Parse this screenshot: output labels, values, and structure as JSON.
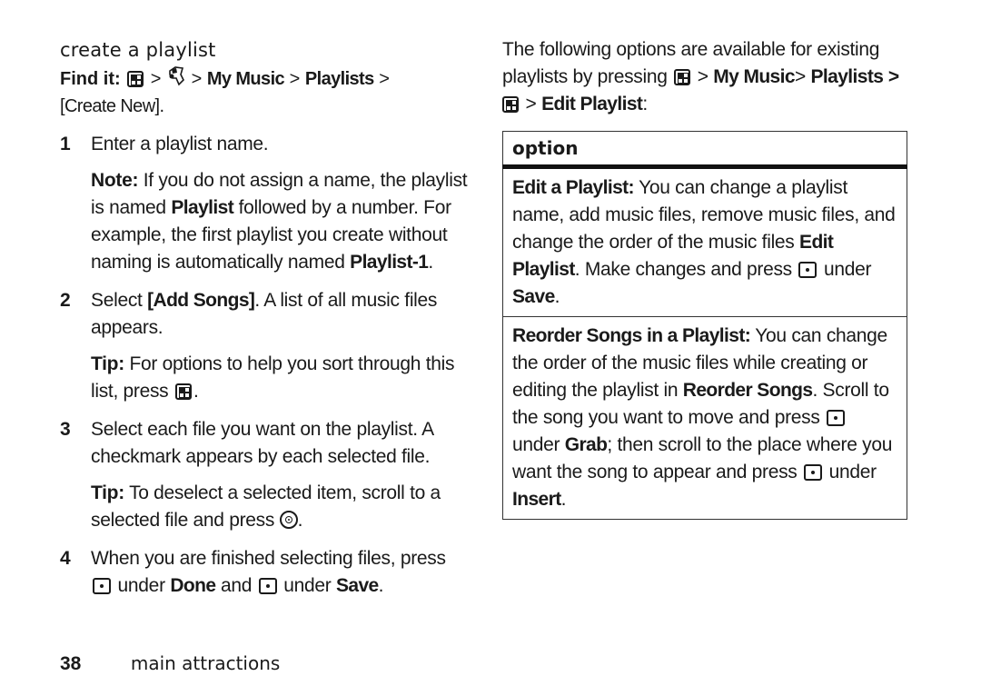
{
  "left": {
    "section_title": "create a playlist",
    "find_it": {
      "label": "Find it:",
      "path": [
        "menu-key-icon",
        ">",
        "music-icon",
        ">",
        "My Music",
        ">",
        "Playlists",
        ">",
        "[Create New]",
        "."
      ],
      "sep": ">",
      "my_music": "My Music",
      "playlists": "Playlists",
      "create_new": "[Create New]"
    },
    "steps": [
      {
        "num": "1",
        "text": "Enter a playlist name.",
        "note": {
          "label": "Note:",
          "parts": [
            "If you do not assign a name, the playlist is named ",
            "Playlist",
            " followed by a number. For example, the first playlist you create without naming is automatically named ",
            "Playlist-1",
            "."
          ]
        }
      },
      {
        "num": "2",
        "parts": [
          "Select ",
          "[Add Songs]",
          ". A list of all music files appears."
        ],
        "tip": {
          "label": "Tip:",
          "text": "For options to help you sort through this list, press",
          "end": "."
        }
      },
      {
        "num": "3",
        "text": "Select each file you want on the playlist. A checkmark appears by each selected file.",
        "tip": {
          "label": "Tip:",
          "text": "To deselect a selected item, scroll to a selected file and press",
          "end": "."
        }
      },
      {
        "num": "4",
        "parts": [
          "When you are finished selecting files, press",
          "under",
          "Done",
          "and",
          "under",
          "Save",
          "."
        ]
      }
    ]
  },
  "right": {
    "intro": {
      "text1": "The following options are available for existing playlists by pressing",
      "sep": ">",
      "my_music": "My Music",
      "sep2": "> ",
      "playlists": "Playlists",
      "sep3": ">",
      "edit_playlist": "Edit Playlist",
      "end": ":"
    },
    "table": {
      "header": "option",
      "rows": [
        {
          "title": "Edit a Playlist:",
          "parts": [
            "You can change a playlist name, add music files, remove music files, and change the order of the music files ",
            "Edit Playlist",
            ". Make changes and press",
            "under",
            "Save",
            "."
          ]
        },
        {
          "title": "Reorder Songs in a Playlist:",
          "parts": [
            "You can change the order of the music files while creating or editing the playlist in ",
            "Reorder Songs",
            ". Scroll to the song you want to move and press",
            "under ",
            "Grab",
            "; then scroll to the place where you want the song to appear and press",
            "under ",
            "Insert",
            "."
          ]
        }
      ]
    }
  },
  "footer": {
    "page_number": "38",
    "chapter": "main attractions"
  }
}
